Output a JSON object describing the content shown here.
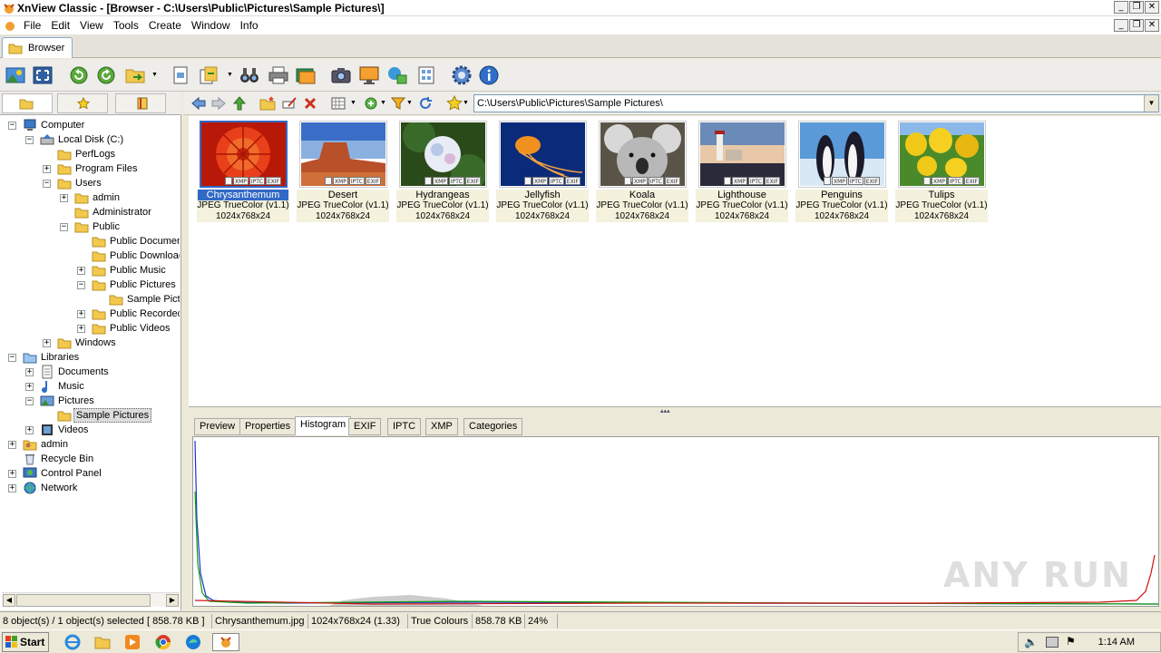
{
  "window": {
    "title": "XnView Classic - [Browser - C:\\Users\\Public\\Pictures\\Sample Pictures\\]",
    "controls": [
      "_",
      "❐",
      "✕"
    ]
  },
  "menu": [
    "File",
    "Edit",
    "View",
    "Tools",
    "Create",
    "Window",
    "Info"
  ],
  "tabs": [
    {
      "label": "Browser"
    }
  ],
  "path": "C:\\Users\\Public\\Pictures\\Sample Pictures\\",
  "tree": [
    {
      "label": "Computer",
      "exp": "−"
    },
    {
      "label": "Local Disk (C:)",
      "exp": "−"
    },
    {
      "label": "PerfLogs",
      "exp": ""
    },
    {
      "label": "Program Files",
      "exp": "+"
    },
    {
      "label": "Users",
      "exp": "−"
    },
    {
      "label": "admin",
      "exp": "+"
    },
    {
      "label": "Administrator",
      "exp": ""
    },
    {
      "label": "Public",
      "exp": "−"
    },
    {
      "label": "Public Documen",
      "exp": ""
    },
    {
      "label": "Public Downloac",
      "exp": ""
    },
    {
      "label": "Public Music",
      "exp": "+"
    },
    {
      "label": "Public Pictures",
      "exp": "−"
    },
    {
      "label": "Sample Pictu",
      "exp": ""
    },
    {
      "label": "Public Recorded",
      "exp": "+"
    },
    {
      "label": "Public Videos",
      "exp": "+"
    },
    {
      "label": "Windows",
      "exp": "+"
    },
    {
      "label": "Libraries",
      "exp": "−"
    },
    {
      "label": "Documents",
      "exp": "+"
    },
    {
      "label": "Music",
      "exp": "+"
    },
    {
      "label": "Pictures",
      "exp": "−"
    },
    {
      "label": "Sample Pictures",
      "exp": ""
    },
    {
      "label": "Videos",
      "exp": "+"
    },
    {
      "label": "admin",
      "exp": "+"
    },
    {
      "label": "Recycle Bin",
      "exp": ""
    },
    {
      "label": "Control Panel",
      "exp": "+"
    },
    {
      "label": "Network",
      "exp": "+"
    }
  ],
  "badges": [
    "XMP",
    "IPTC",
    "EXIF"
  ],
  "thumbnails": [
    {
      "name": "Chrysanthemum",
      "format": "JPEG TrueColor (v1.1)",
      "dims": "1024x768x24",
      "selected": true
    },
    {
      "name": "Desert",
      "format": "JPEG TrueColor (v1.1)",
      "dims": "1024x768x24"
    },
    {
      "name": "Hydrangeas",
      "format": "JPEG TrueColor (v1.1)",
      "dims": "1024x768x24"
    },
    {
      "name": "Jellyfish",
      "format": "JPEG TrueColor (v1.1)",
      "dims": "1024x768x24"
    },
    {
      "name": "Koala",
      "format": "JPEG TrueColor (v1.1)",
      "dims": "1024x768x24"
    },
    {
      "name": "Lighthouse",
      "format": "JPEG TrueColor (v1.1)",
      "dims": "1024x768x24"
    },
    {
      "name": "Penguins",
      "format": "JPEG TrueColor (v1.1)",
      "dims": "1024x768x24"
    },
    {
      "name": "Tulips",
      "format": "JPEG TrueColor (v1.1)",
      "dims": "1024x768x24"
    }
  ],
  "bottom_tabs": [
    "Preview",
    "Properties",
    "Histogram",
    "EXIF",
    "IPTC",
    "XMP",
    "Categories"
  ],
  "active_bottom_tab": "Histogram",
  "status": {
    "selection": "8 object(s) / 1 object(s) selected  [ 858.78 KB ]",
    "filename": "Chrysanthemum.jpg",
    "dims": "1024x768x24 (1.33)",
    "colours": "True Colours",
    "size": "858.78 KB",
    "zoom": "24%"
  },
  "watermark": "ANY RUN",
  "taskbar": {
    "start": "Start",
    "clock": "1:14 AM"
  },
  "colors": {
    "selection": "#3169c6",
    "thumb_info_bg": "#f4f1dc"
  }
}
